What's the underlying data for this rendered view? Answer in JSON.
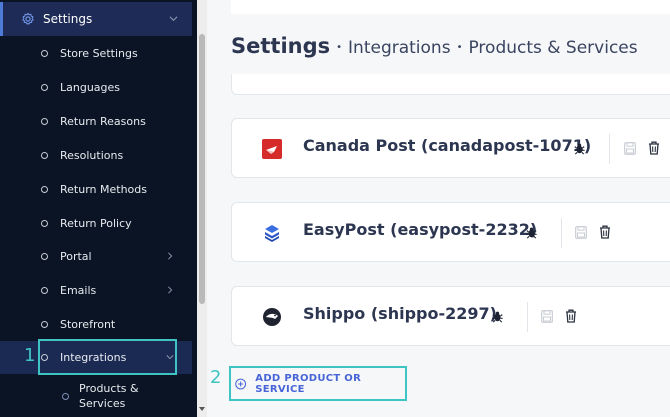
{
  "sidebar": {
    "section_label": "Settings",
    "items": [
      {
        "label": "Store Settings"
      },
      {
        "label": "Languages"
      },
      {
        "label": "Return Reasons"
      },
      {
        "label": "Resolutions"
      },
      {
        "label": "Return Methods"
      },
      {
        "label": "Return Policy"
      },
      {
        "label": "Portal",
        "has_submenu": true
      },
      {
        "label": "Emails",
        "has_submenu": true
      },
      {
        "label": "Storefront"
      },
      {
        "label": "Integrations",
        "active": true,
        "expanded": true
      }
    ],
    "subitem": {
      "label_line1": "Products &",
      "label_line2": "Services"
    }
  },
  "breadcrumb": {
    "title": "Settings",
    "sep": "•",
    "level1": "Integrations",
    "level2": "Products & Services"
  },
  "integrations": [
    {
      "name": "Canada Post (canadapost-1071)",
      "logo": "canada-post-logo"
    },
    {
      "name": "EasyPost (easypost-2232)",
      "logo": "easypost-logo"
    },
    {
      "name": "Shippo (shippo-2297)",
      "logo": "shippo-logo"
    }
  ],
  "add_button": {
    "label": "ADD PRODUCT OR SERVICE"
  },
  "callouts": {
    "one": "1",
    "two": "2"
  },
  "colors": {
    "sidebar_bg": "#0a1424",
    "sidebar_active": "#1b2a52",
    "accent_blue": "#4865d8",
    "highlight_teal": "#3ec4c3",
    "canada_post_red": "#d62b2b"
  }
}
